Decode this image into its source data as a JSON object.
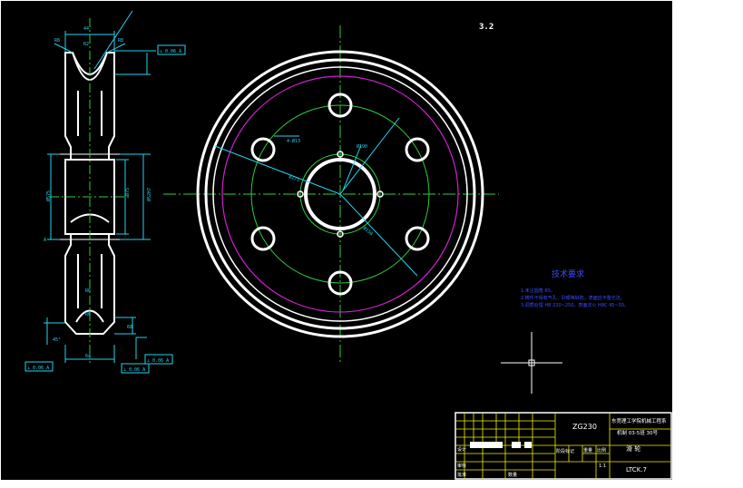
{
  "drawing": {
    "stamp": "3.2",
    "background": "#000000",
    "colors": {
      "outline": "#ffffff",
      "center_line": "#2ecc40",
      "dimension": "#22d3ee",
      "pitch_circle": "#d020d0",
      "notes": "#3a4cff",
      "title_block": "#f2f200"
    }
  },
  "section_view": {
    "labels": {
      "top_width": "44",
      "left_bevel": "R8",
      "right_bevel": "R8",
      "groove_radius": "R2",
      "tol_top": "⊥ 0.06 A",
      "hub_dia": "Ø75",
      "bore_dia": "Ø52H7",
      "left_dia": "Ø575",
      "side_a": "A",
      "mid_r": "R6",
      "low_r": "R6",
      "hub_len": "68",
      "tol_right": "⊥ 0.06 A",
      "tol_bottom_left": "⊥ 0.06 A",
      "tol_bottom_mid": "⊥ 0.06 A",
      "base_width": "64",
      "chamfer": "45°"
    }
  },
  "front_view": {
    "labels": {
      "bolt_circle": "4-Ø13",
      "bore": "Ø190",
      "dia_a": "Ø275",
      "dia_b": "Ø150"
    }
  },
  "tech_requirements": {
    "title": "技术要求",
    "items": [
      "1.未注圆角  R5。",
      "2.铸件不得有气孔、砂眼等缺陷，表面应平整光洁。",
      "3.调质处理 HB 220~250，表面淬火 HRC 45~50。"
    ]
  },
  "title_block": {
    "material": "ZG230",
    "school": "东莞理工学院机械工程系",
    "class_info": "机制 03-5班 30号",
    "part_name": "滑  轮",
    "drawing_no": "LTCK.7",
    "scale_label": "比例",
    "qty_label": "数量",
    "weight_label": "重量",
    "material_label": "材料",
    "sheet": "1:1",
    "row_design": "设计",
    "row_check": "审核",
    "row_approve": "批准",
    "row_stage": "阶段标记"
  }
}
